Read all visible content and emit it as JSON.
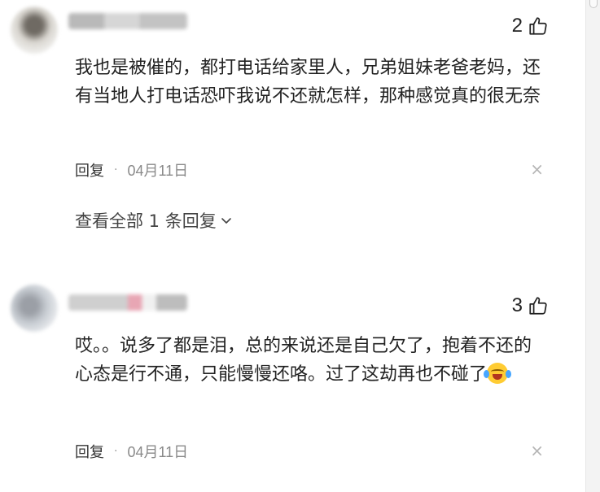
{
  "comments": [
    {
      "likes": "2",
      "text": "我也是被催的，都打电话给家里人，兄弟姐妹老爸老妈，还有当地人打电话恐吓我说不还就怎样，那种感觉真的很无奈",
      "reply_label": "回复",
      "separator": "·",
      "date": "04月11日",
      "close_glyph": "×",
      "view_replies": "查看全部 1 条回复"
    },
    {
      "likes": "3",
      "text": "哎。。说多了都是泪，总的来说还是自己欠了，抱着不还的心态是行不通，只能慢慢还咯。过了这劫再也不碰了",
      "emoji": "crying-laughing-emoji",
      "reply_label": "回复",
      "separator": "·",
      "date": "04月11日",
      "close_glyph": "×"
    }
  ],
  "icons": {
    "like": "thumbs-up-icon",
    "expand": "chevron-down-icon",
    "close": "close-icon"
  }
}
